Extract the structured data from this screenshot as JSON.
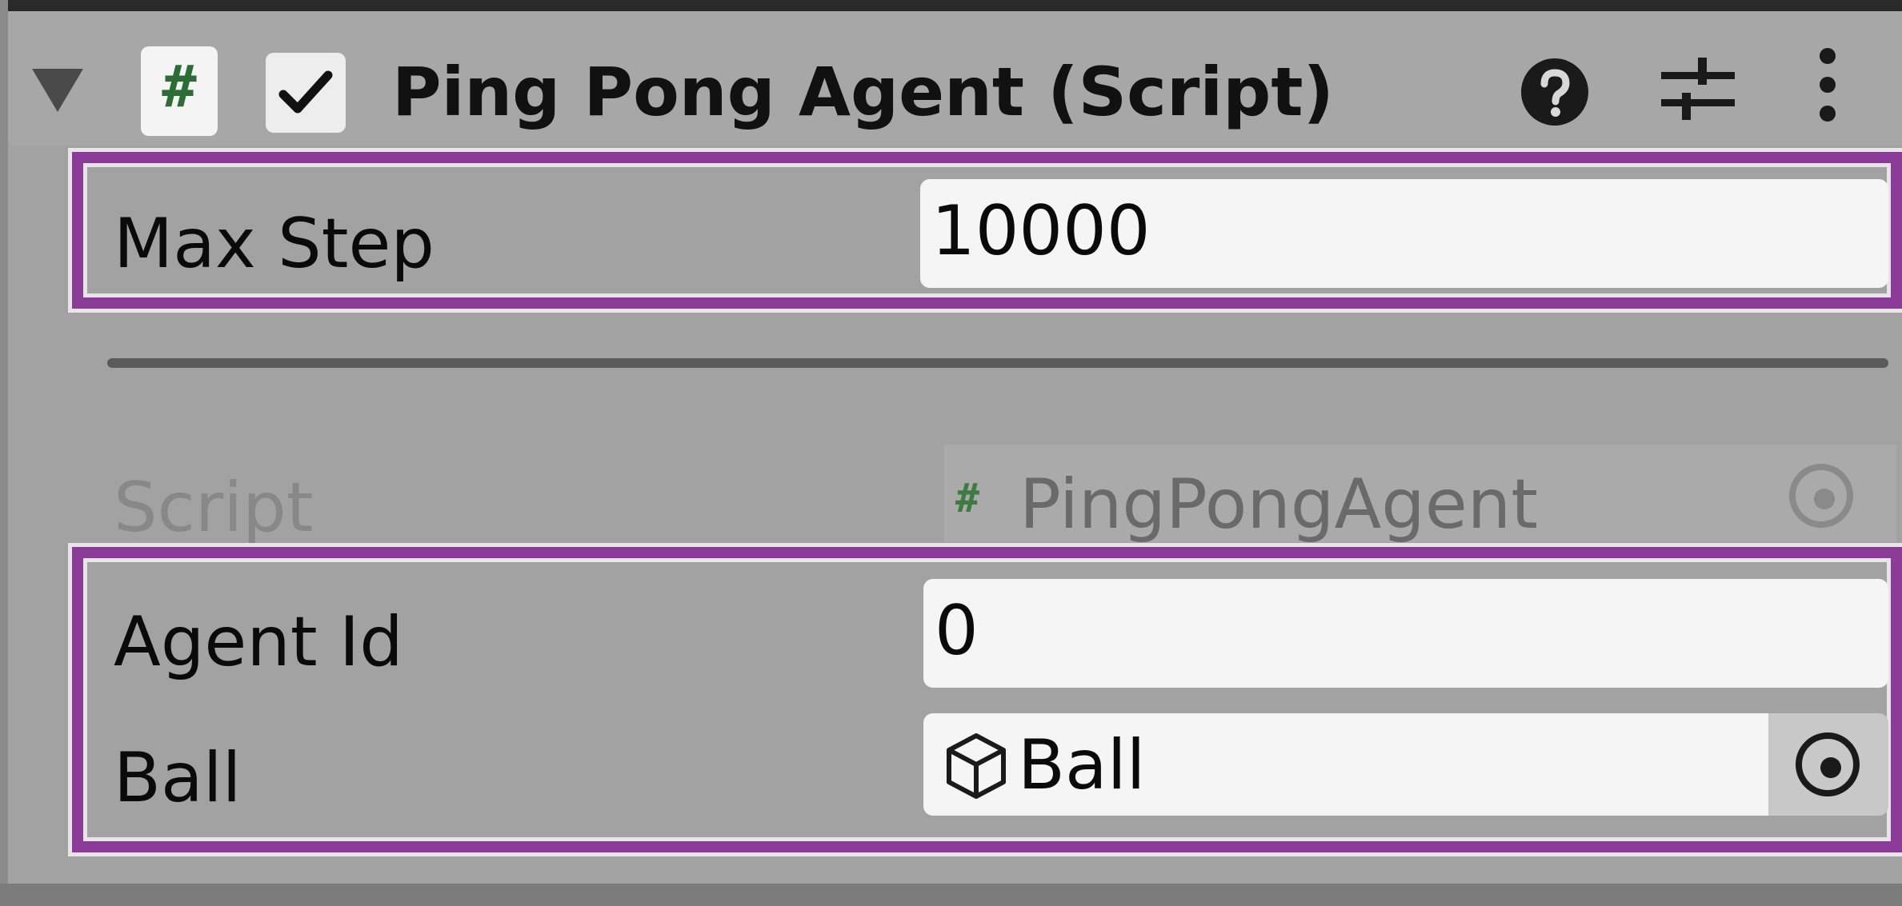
{
  "component": {
    "title": "Ping Pong Agent (Script)",
    "script_icon_glyph": "#",
    "enabled": true,
    "icons": [
      "foldout-arrow-icon",
      "script-icon",
      "help-icon",
      "presets-icon",
      "context-menu-icon"
    ]
  },
  "fields": {
    "max_step": {
      "label": "Max Step",
      "value": "10000"
    },
    "script": {
      "label": "Script",
      "value": "PingPongAgent",
      "glyph": "#"
    },
    "agent_id": {
      "label": "Agent Id",
      "value": "0"
    },
    "ball": {
      "label": "Ball",
      "value": "Ball"
    }
  },
  "colors": {
    "highlight": "#8b3b98",
    "panel": "#a2a2a2",
    "field": "#f5f5f5",
    "script_icon": "#2c6d35"
  }
}
